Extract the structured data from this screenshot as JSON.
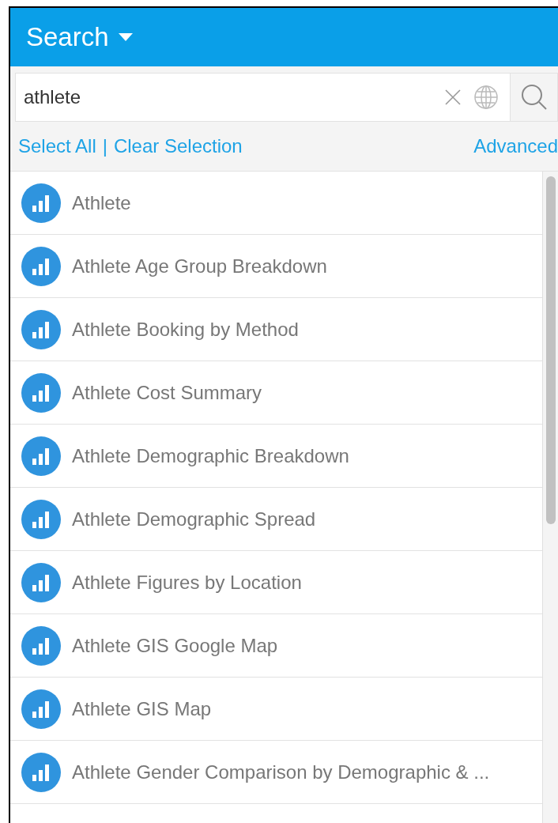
{
  "header": {
    "title": "Search"
  },
  "search": {
    "value": "athlete"
  },
  "links": [
    "Select All",
    "Clear Selection"
  ],
  "separator": "|",
  "advanced": "Advanced",
  "results": [
    {
      "title": "Athlete"
    },
    {
      "title": "Athlete Age Group Breakdown"
    },
    {
      "title": "Athlete Booking by Method"
    },
    {
      "title": "Athlete Cost Summary"
    },
    {
      "title": "Athlete Demographic Breakdown"
    },
    {
      "title": "Athlete Demographic Spread"
    },
    {
      "title": "Athlete Figures by Location"
    },
    {
      "title": "Athlete GIS Google Map"
    },
    {
      "title": "Athlete GIS Map"
    },
    {
      "title": "Athlete Gender Comparison by Demographic & ..."
    }
  ]
}
